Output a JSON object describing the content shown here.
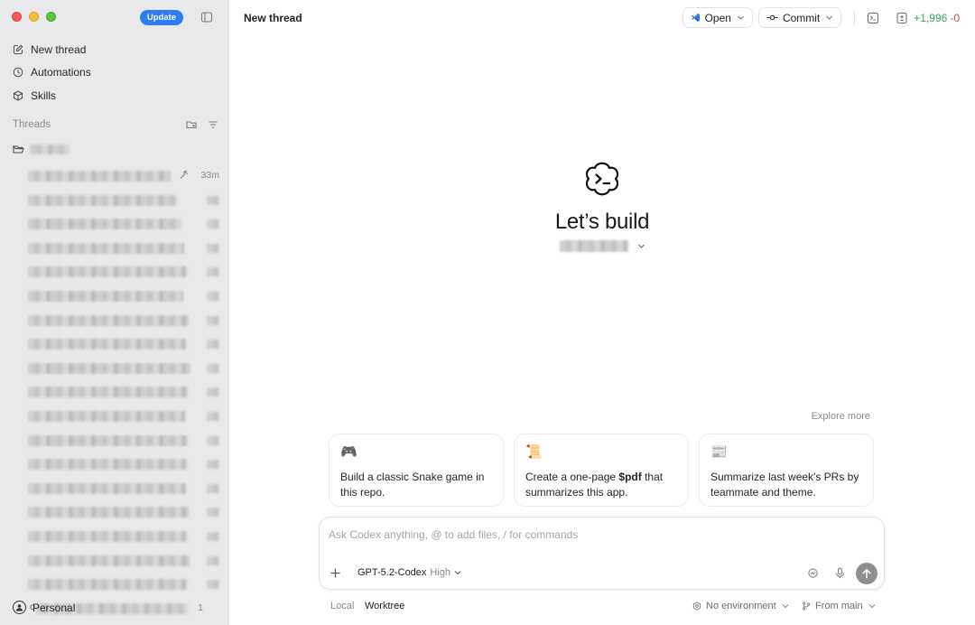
{
  "sidebar": {
    "update_label": "Update",
    "nav": [
      {
        "label": "New thread",
        "icon": "edit-icon"
      },
      {
        "label": "Automations",
        "icon": "clock-icon"
      },
      {
        "label": "Skills",
        "icon": "cube-icon"
      }
    ],
    "threads_label": "Threads",
    "first_thread_time": "33m",
    "last_thread_prefix": "o",
    "last_thread_time": "1",
    "account_label": "Personal"
  },
  "main": {
    "title": "New thread",
    "open_label": "Open",
    "commit_label": "Commit",
    "diff_added": "+1,996",
    "diff_removed": "-0",
    "hero_heading": "Let’s build",
    "explore_label": "Explore more",
    "cards": [
      {
        "emoji": "🎮",
        "pre": "Build a classic Snake game in this repo.",
        "bold": "",
        "post": ""
      },
      {
        "emoji": "📜",
        "pre": "Create a one-page ",
        "bold": "$pdf",
        "post": " that summarizes this app."
      },
      {
        "emoji": "📰",
        "pre": "Summarize last week's PRs by teammate and theme.",
        "bold": "",
        "post": ""
      }
    ],
    "composer": {
      "placeholder": "Ask Codex anything, @ to add files, / for commands",
      "model": "GPT-5.2-Codex",
      "effort": "High"
    },
    "footer": {
      "local": "Local",
      "worktree": "Worktree",
      "environment": "No environment",
      "branch": "From main"
    }
  },
  "colors": {
    "update_button": "#2f7cf6",
    "diff_added": "#3fa35a",
    "diff_removed": "#d64b3f",
    "send_button": "#8f8f8f"
  }
}
